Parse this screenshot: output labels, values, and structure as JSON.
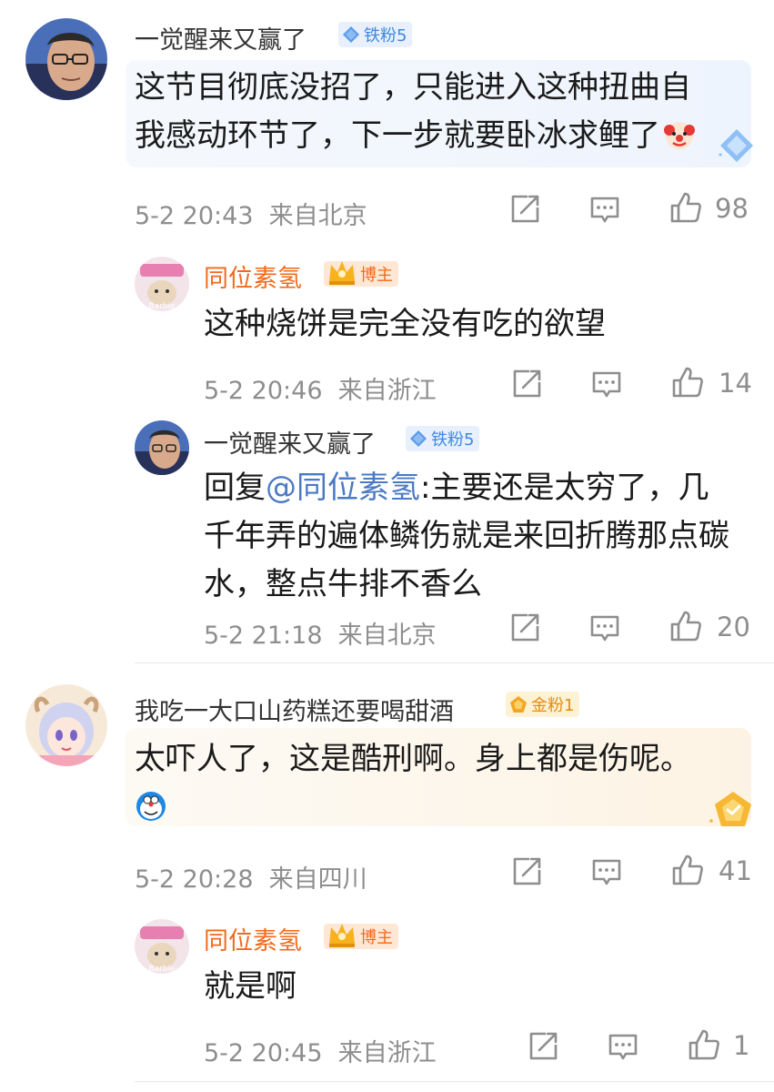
{
  "comments": [
    {
      "user": "一觉醒来又赢了",
      "badge": "铁粉5",
      "text": "这节目彻底没招了，只能进入这种扭曲自我感动环节了，下一步就要卧冰求鲤了",
      "time": "5-2 20:43",
      "location": "来自北京",
      "likes": "98",
      "replies": [
        {
          "user": "同位素氢",
          "badge": "博主",
          "text": "这种烧饼是完全没有吃的欲望",
          "time": "5-2 20:46",
          "location": "来自浙江",
          "likes": "14"
        },
        {
          "user": "一觉醒来又赢了",
          "badge": "铁粉5",
          "reply_prefix": "回复",
          "mention": "@同位素氢",
          "text": ":主要还是太穷了，几千年弄的遍体鳞伤就是来回折腾那点碳水，整点牛排不香么",
          "time": "5-2 21:18",
          "location": "来自北京",
          "likes": "20"
        }
      ]
    },
    {
      "user": "我吃一大口山药糕还要喝甜酒",
      "badge": "金粉1",
      "text": "太吓人了，这是酷刑啊。身上都是伤呢。",
      "time": "5-2 20:28",
      "location": "来自四川",
      "likes": "41",
      "replies": [
        {
          "user": "同位素氢",
          "badge": "博主",
          "text": "就是啊",
          "time": "5-2 20:45",
          "location": "来自浙江",
          "likes": "1"
        }
      ]
    }
  ],
  "icons": {
    "share": "share-icon",
    "comment": "comment-icon",
    "like": "like-icon",
    "fan_badge": "diamond-icon",
    "gold_badge": "pentagon-icon",
    "host_badge": "crown-icon",
    "emoji_clown": "clown-emoji",
    "emoji_doraemon": "doraemon-emoji"
  },
  "colors": {
    "name_default": "#333333",
    "name_host": "#f06a1b",
    "meta": "#8e8e8e",
    "mention": "#4b7ac5",
    "badge_blue": "#3f88e0",
    "badge_gold": "#e38b12"
  }
}
